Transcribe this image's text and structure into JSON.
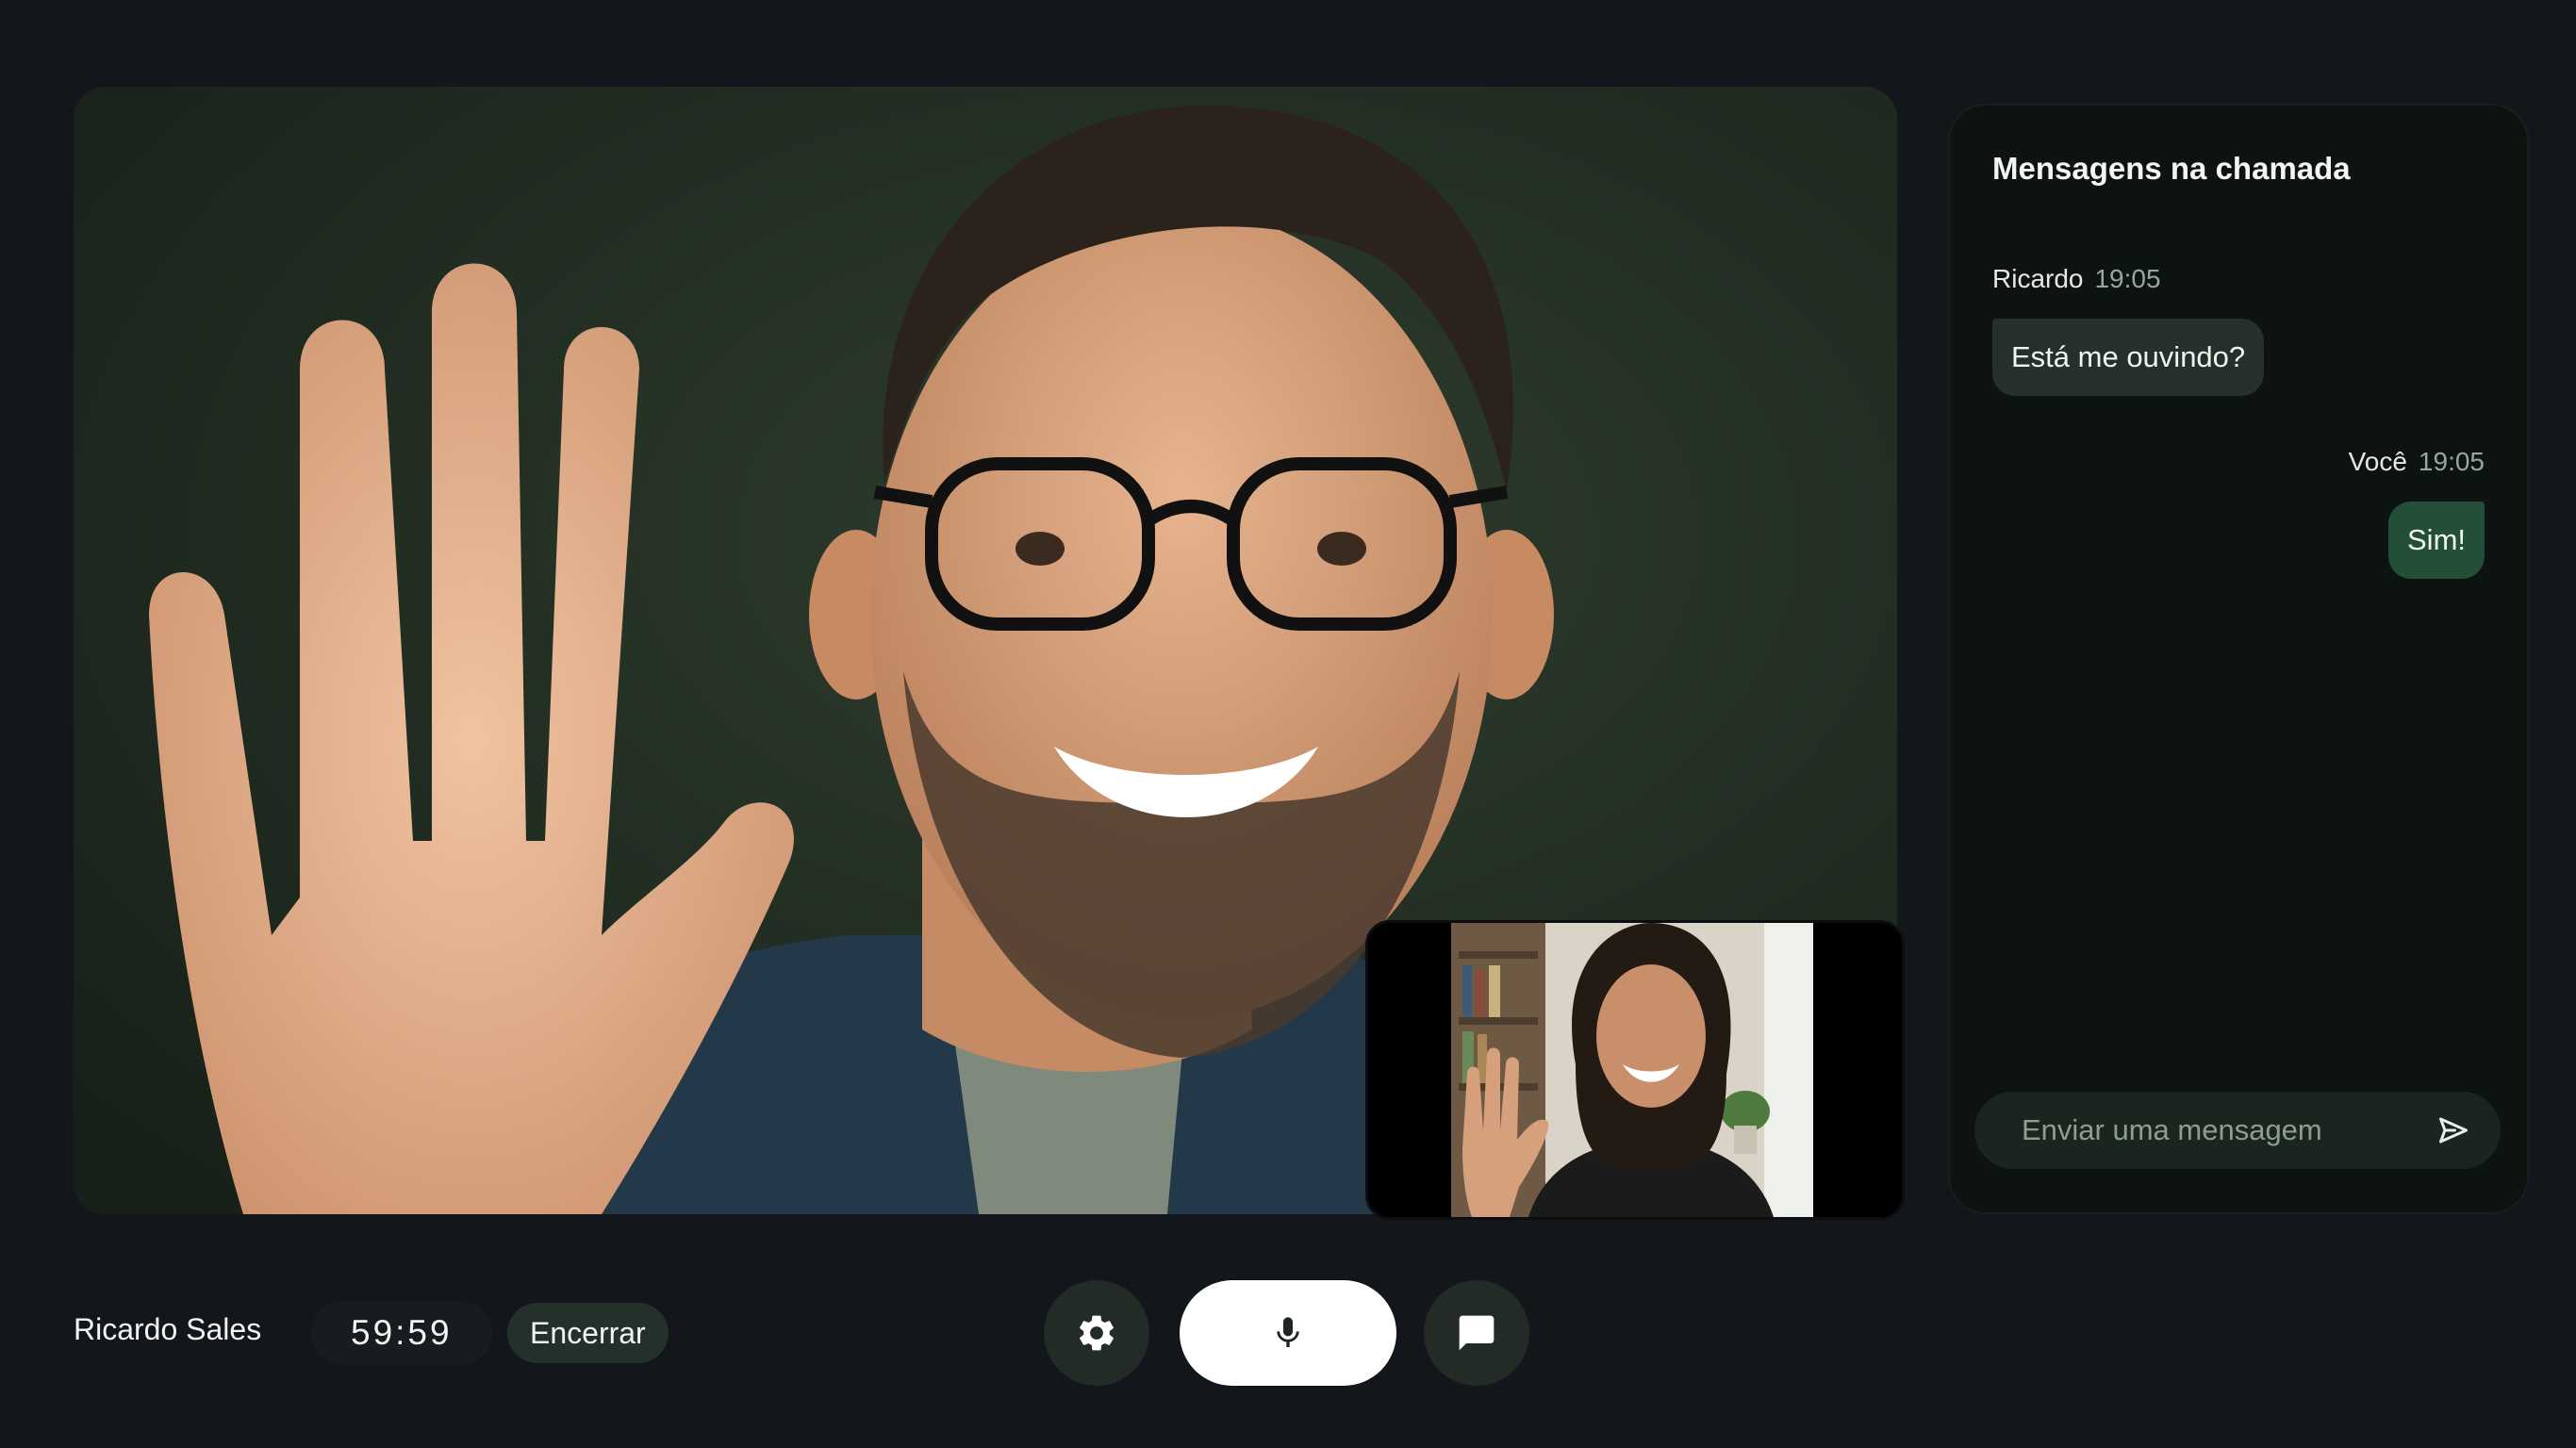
{
  "chat": {
    "title": "Mensagens na chamada",
    "messages": [
      {
        "sender": "Ricardo",
        "time": "19:05",
        "text": "Está me ouvindo?",
        "direction": "incoming"
      },
      {
        "sender": "Você",
        "time": "19:05",
        "text": "Sim!",
        "direction": "outgoing"
      }
    ],
    "input_placeholder": "Enviar uma mensagem",
    "send_icon": "send-icon"
  },
  "call": {
    "caller_name": "Ricardo Sales",
    "timer": "59:59",
    "end_label": "Encerrar"
  },
  "controls": {
    "settings_icon": "gear-icon",
    "mic_icon": "mic-icon",
    "chat_icon": "chat-icon"
  },
  "colors": {
    "background": "#13161a",
    "panel": "#0c1310",
    "incoming_bubble": "#25302a",
    "outgoing_bubble": "#234e37",
    "mic_button": "#ffffff"
  }
}
